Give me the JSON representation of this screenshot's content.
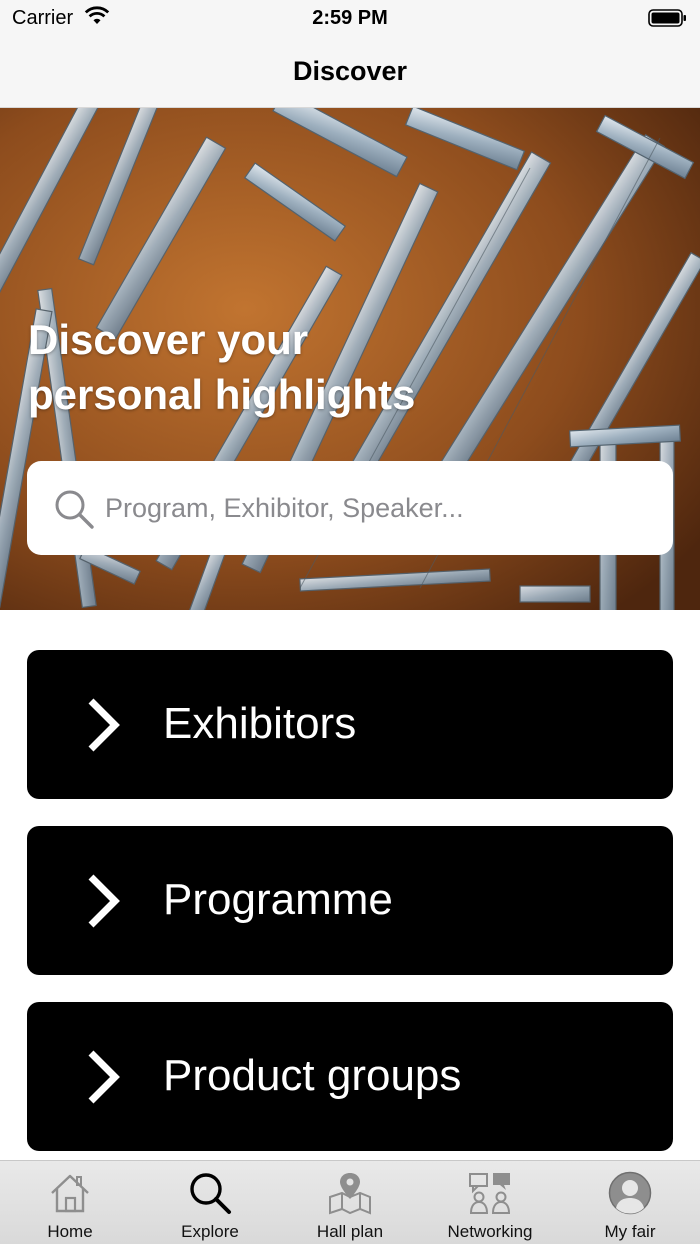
{
  "status_bar": {
    "carrier": "Carrier",
    "time": "2:59 PM"
  },
  "nav": {
    "title": "Discover"
  },
  "hero": {
    "title_line1": "Discover your",
    "title_line2": "personal highlights",
    "search": {
      "placeholder": "Program, Exhibitor, Speaker...",
      "icon": "search-icon"
    }
  },
  "categories": [
    {
      "label": "Exhibitors",
      "icon": "chevron-right-icon"
    },
    {
      "label": "Programme",
      "icon": "chevron-right-icon"
    },
    {
      "label": "Product groups",
      "icon": "chevron-right-icon"
    }
  ],
  "tab_bar": {
    "active_color": "#000000",
    "inactive_color": "#8e8e8e",
    "items": [
      {
        "label": "Home",
        "icon": "home-icon",
        "active": false
      },
      {
        "label": "Explore",
        "icon": "search-icon",
        "active": true
      },
      {
        "label": "Hall plan",
        "icon": "map-pin-icon",
        "active": false
      },
      {
        "label": "Networking",
        "icon": "networking-icon",
        "active": false
      },
      {
        "label": "My fair",
        "icon": "profile-icon",
        "active": false
      }
    ]
  }
}
